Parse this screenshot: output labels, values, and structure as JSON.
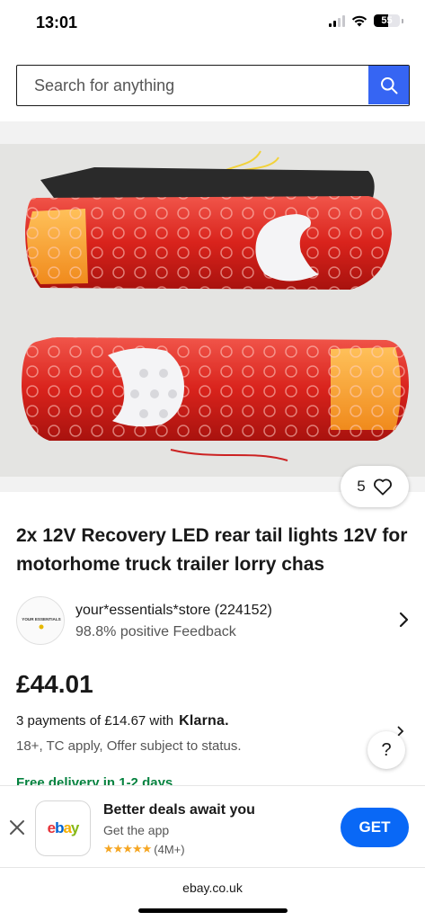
{
  "status": {
    "time": "13:01",
    "battery": "55",
    "battery_level_pct": 55
  },
  "search": {
    "placeholder": "Search for anything",
    "button_icon": "search-icon"
  },
  "product": {
    "image_alt": "Pair of red LED rear tail lights",
    "watch_count": "5",
    "watch_icon": "heart-icon",
    "title": "2x 12V Recovery LED rear tail lights 12V for motorhome truck trailer lorry chas"
  },
  "seller": {
    "name": "your*essentials*store (224152)",
    "feedback": "98.8% positive Feedback",
    "avatar_text": "YOUR ESSENTIALS"
  },
  "pricing": {
    "price": "£44.01",
    "installments": "3 payments of £14.67 with",
    "klarna": "Klarna.",
    "terms": "18+, TC apply, Offer subject to status."
  },
  "delivery": {
    "text": "Free delivery in 1-2 days"
  },
  "help": {
    "label": "?"
  },
  "app_banner": {
    "title": "Better deals await you",
    "subtitle": "Get the app",
    "stars": "★★★★★",
    "rating_count": "(4M+)",
    "get_label": "GET",
    "logo_letters": [
      "e",
      "b",
      "a",
      "y"
    ]
  },
  "browser": {
    "address": "ebay.co.uk"
  },
  "colors": {
    "ebay_blue": "#3665f3",
    "get_blue": "#0968f6",
    "delivery_green": "#05823f",
    "star_orange": "#f5a623"
  }
}
